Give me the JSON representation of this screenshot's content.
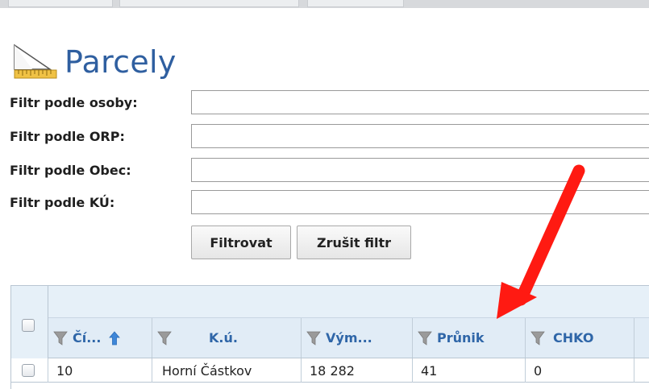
{
  "page": {
    "title": "Parcely"
  },
  "filters": [
    {
      "label": "Filtr podle osoby:",
      "value": "",
      "placeholder": ""
    },
    {
      "label": "Filtr podle ORP:",
      "value": "",
      "placeholder": ""
    },
    {
      "label": "Filtr podle Obec:",
      "value": "",
      "placeholder": ""
    },
    {
      "label": "Filtr podle KÚ:",
      "value": "",
      "placeholder": ""
    }
  ],
  "buttons": {
    "filter_label": "Filtrovat",
    "clear_label": "Zrušit filtr"
  },
  "grid": {
    "columns": [
      {
        "label": "Čí...",
        "sort": "ascending"
      },
      {
        "label": "K.ú."
      },
      {
        "label": "Vým..."
      },
      {
        "label": "Průnik"
      },
      {
        "label": "CHKO"
      }
    ],
    "rows": [
      {
        "cells": [
          "10",
          "Horní Částkov",
          "18 282",
          "41",
          "0"
        ]
      }
    ]
  },
  "icons": {
    "title_icon": "ruler-triangle-icon",
    "filter_icon": "funnel-icon",
    "sort_icon": "sort-ascending-arrow-icon",
    "annotation": "red-arrow-annotation"
  },
  "colors": {
    "title": "#2f5fa0",
    "header_text": "#2f66a8",
    "header_bg": "#e1ecf6",
    "arrow": "#ff1a12",
    "sort_arrow": "#3d86d8"
  }
}
